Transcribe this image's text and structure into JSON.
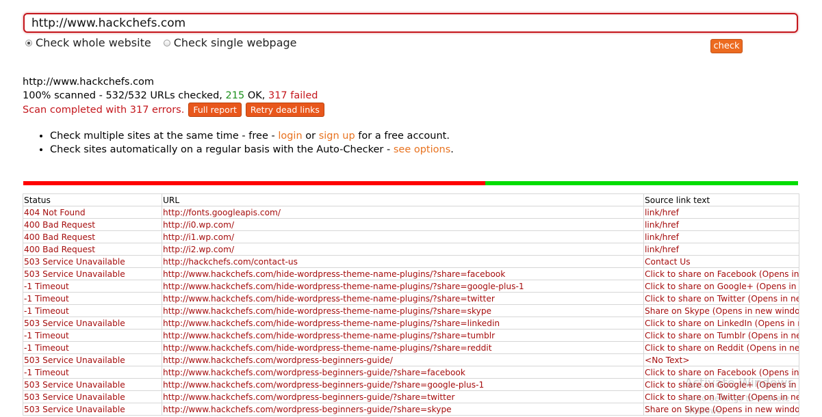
{
  "search": {
    "value": "http://www.hackchefs.com"
  },
  "mode": {
    "options": [
      {
        "label": "Check whole website",
        "checked": true
      },
      {
        "label": "Check single webpage",
        "checked": false
      }
    ]
  },
  "check_button": "check",
  "result": {
    "site": "http://www.hackchefs.com",
    "percent": "100%",
    "scanned_label": "scanned -",
    "url_count": "532/532",
    "urls_checked_label": "URLs checked,",
    "ok_count": "215",
    "ok_label": "OK,",
    "failed_count": "317",
    "failed_label": "failed",
    "completed_message": "Scan completed with 317 errors.",
    "full_report_label": "Full report",
    "retry_label": "Retry dead links"
  },
  "bullets": {
    "line1_prefix": "Check multiple sites at the same time - free - ",
    "login": "login",
    "or": " or ",
    "signup": "sign up",
    "line1_suffix": " for a free account.",
    "line2_prefix": "Check sites automatically on a regular basis with the Auto-Checker - ",
    "see_options": "see options",
    "line2_suffix": "."
  },
  "progress": {
    "failed_fraction": 0.5959,
    "ok_fraction": 0.4041,
    "failed_color": "#ff0000",
    "ok_color": "#00dd00"
  },
  "table": {
    "headers": [
      "Status",
      "URL",
      "Source link text"
    ],
    "rows": [
      [
        "404 Not Found",
        "http://fonts.googleapis.com/",
        "link/href"
      ],
      [
        "400 Bad Request",
        "http://i0.wp.com/",
        "link/href"
      ],
      [
        "400 Bad Request",
        "http://i1.wp.com/",
        "link/href"
      ],
      [
        "400 Bad Request",
        "http://i2.wp.com/",
        "link/href"
      ],
      [
        "503 Service Unavailable",
        "http://hackchefs.com/contact-us",
        "Contact Us"
      ],
      [
        "503 Service Unavailable",
        "http://www.hackchefs.com/hide-wordpress-theme-name-plugins/?share=facebook",
        "Click to share on Facebook (Opens in new window)"
      ],
      [
        "-1 Timeout",
        "http://www.hackchefs.com/hide-wordpress-theme-name-plugins/?share=google-plus-1",
        "Click to share on Google+ (Opens in new window)"
      ],
      [
        "-1 Timeout",
        "http://www.hackchefs.com/hide-wordpress-theme-name-plugins/?share=twitter",
        "Click to share on Twitter (Opens in new window)"
      ],
      [
        "-1 Timeout",
        "http://www.hackchefs.com/hide-wordpress-theme-name-plugins/?share=skype",
        "Share on Skype (Opens in new window)"
      ],
      [
        "503 Service Unavailable",
        "http://www.hackchefs.com/hide-wordpress-theme-name-plugins/?share=linkedin",
        "Click to share on LinkedIn (Opens in new window)"
      ],
      [
        "-1 Timeout",
        "http://www.hackchefs.com/hide-wordpress-theme-name-plugins/?share=tumblr",
        "Click to share on Tumblr (Opens in new window)"
      ],
      [
        "-1 Timeout",
        "http://www.hackchefs.com/hide-wordpress-theme-name-plugins/?share=reddit",
        "Click to share on Reddit (Opens in new window)"
      ],
      [
        "503 Service Unavailable",
        "http://www.hackchefs.com/wordpress-beginners-guide/",
        "<No Text>"
      ],
      [
        "-1 Timeout",
        "http://www.hackchefs.com/wordpress-beginners-guide/?share=facebook",
        "Click to share on Facebook (Opens in new window)"
      ],
      [
        "503 Service Unavailable",
        "http://www.hackchefs.com/wordpress-beginners-guide/?share=google-plus-1",
        "Click to share on Google+ (Opens in new window)"
      ],
      [
        "503 Service Unavailable",
        "http://www.hackchefs.com/wordpress-beginners-guide/?share=twitter",
        "Click to share on Twitter (Opens in new window)"
      ],
      [
        "503 Service Unavailable",
        "http://www.hackchefs.com/wordpress-beginners-guide/?share=skype",
        "Share on Skype (Opens in new window)"
      ]
    ]
  },
  "watermark": {
    "title": "Activate Windows",
    "subtitle": "Go to Settings to activate Windows."
  }
}
